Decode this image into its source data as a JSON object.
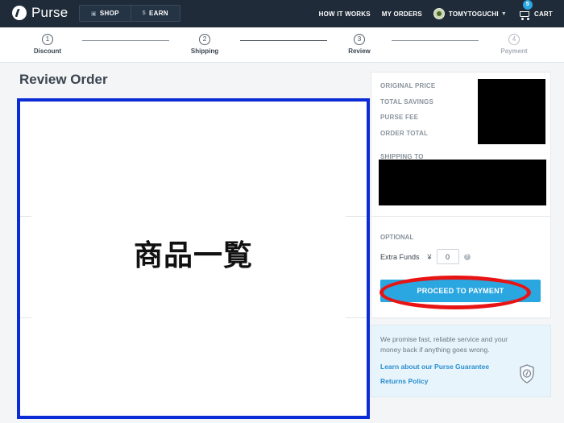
{
  "brand": {
    "name": "Purse"
  },
  "nav": {
    "shop_label": "SHOP",
    "earn_label": "EARN",
    "earn_icon": "$",
    "how_it_works": "HOW IT WORKS",
    "my_orders": "MY ORDERS",
    "user_name": "TOMYTOGUCHI",
    "cart_label": "CART",
    "cart_count": "5"
  },
  "steps": [
    {
      "number": "1",
      "label": "Discount",
      "active": true
    },
    {
      "number": "2",
      "label": "Shipping",
      "active": true
    },
    {
      "number": "3",
      "label": "Review",
      "active": true
    },
    {
      "number": "4",
      "label": "Payment",
      "active": false
    }
  ],
  "page": {
    "title": "Review Order"
  },
  "items_panel": {
    "label": "商品一覧"
  },
  "summary": {
    "original_price": "ORIGINAL PRICE",
    "total_savings": "TOTAL SAVINGS",
    "purse_fee": "PURSE FEE",
    "order_total": "ORDER TOTAL",
    "shipping_to": "SHIPPING TO",
    "optional": "OPTIONAL",
    "extra_funds_label": "Extra Funds",
    "currency_symbol": "¥",
    "extra_funds_value": "0",
    "help_icon": "?",
    "proceed_label": "PROCEED TO PAYMENT"
  },
  "guarantee": {
    "text": "We promise fast, reliable service and your money back if anything goes wrong.",
    "learn_link": "Learn about our Purse Guarantee",
    "returns_link": "Returns Policy"
  },
  "colors": {
    "nav_bg": "#1f2b38",
    "accent": "#2aa6e0",
    "highlight_blue": "#0a2bd6",
    "highlight_red": "#e81414"
  }
}
